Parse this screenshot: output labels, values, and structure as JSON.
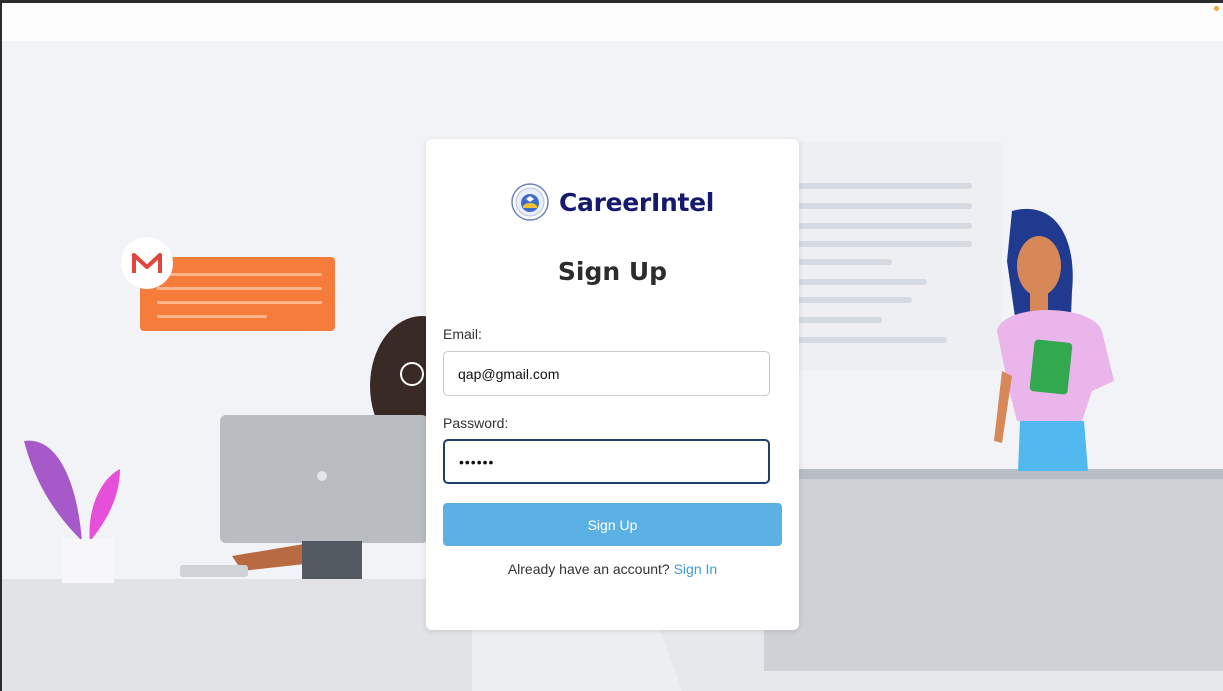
{
  "brand": {
    "name": "CareerIntel",
    "logo_icon": "careerintel-emblem-icon"
  },
  "form": {
    "title": "Sign Up",
    "email_label": "Email:",
    "email_value": "qap@gmail.com",
    "password_label": "Password:",
    "password_value": "••••••",
    "submit_label": "Sign Up",
    "have_account_text": "Already have an account?",
    "signin_link": "Sign In"
  },
  "background": {
    "mail_icon": "gmail-icon"
  },
  "colors": {
    "brand": "#16196e",
    "button": "#5bb0e4",
    "link": "#3d9bd9",
    "focus_border": "#1f3f6a",
    "accent_orange": "#f67c3b"
  }
}
